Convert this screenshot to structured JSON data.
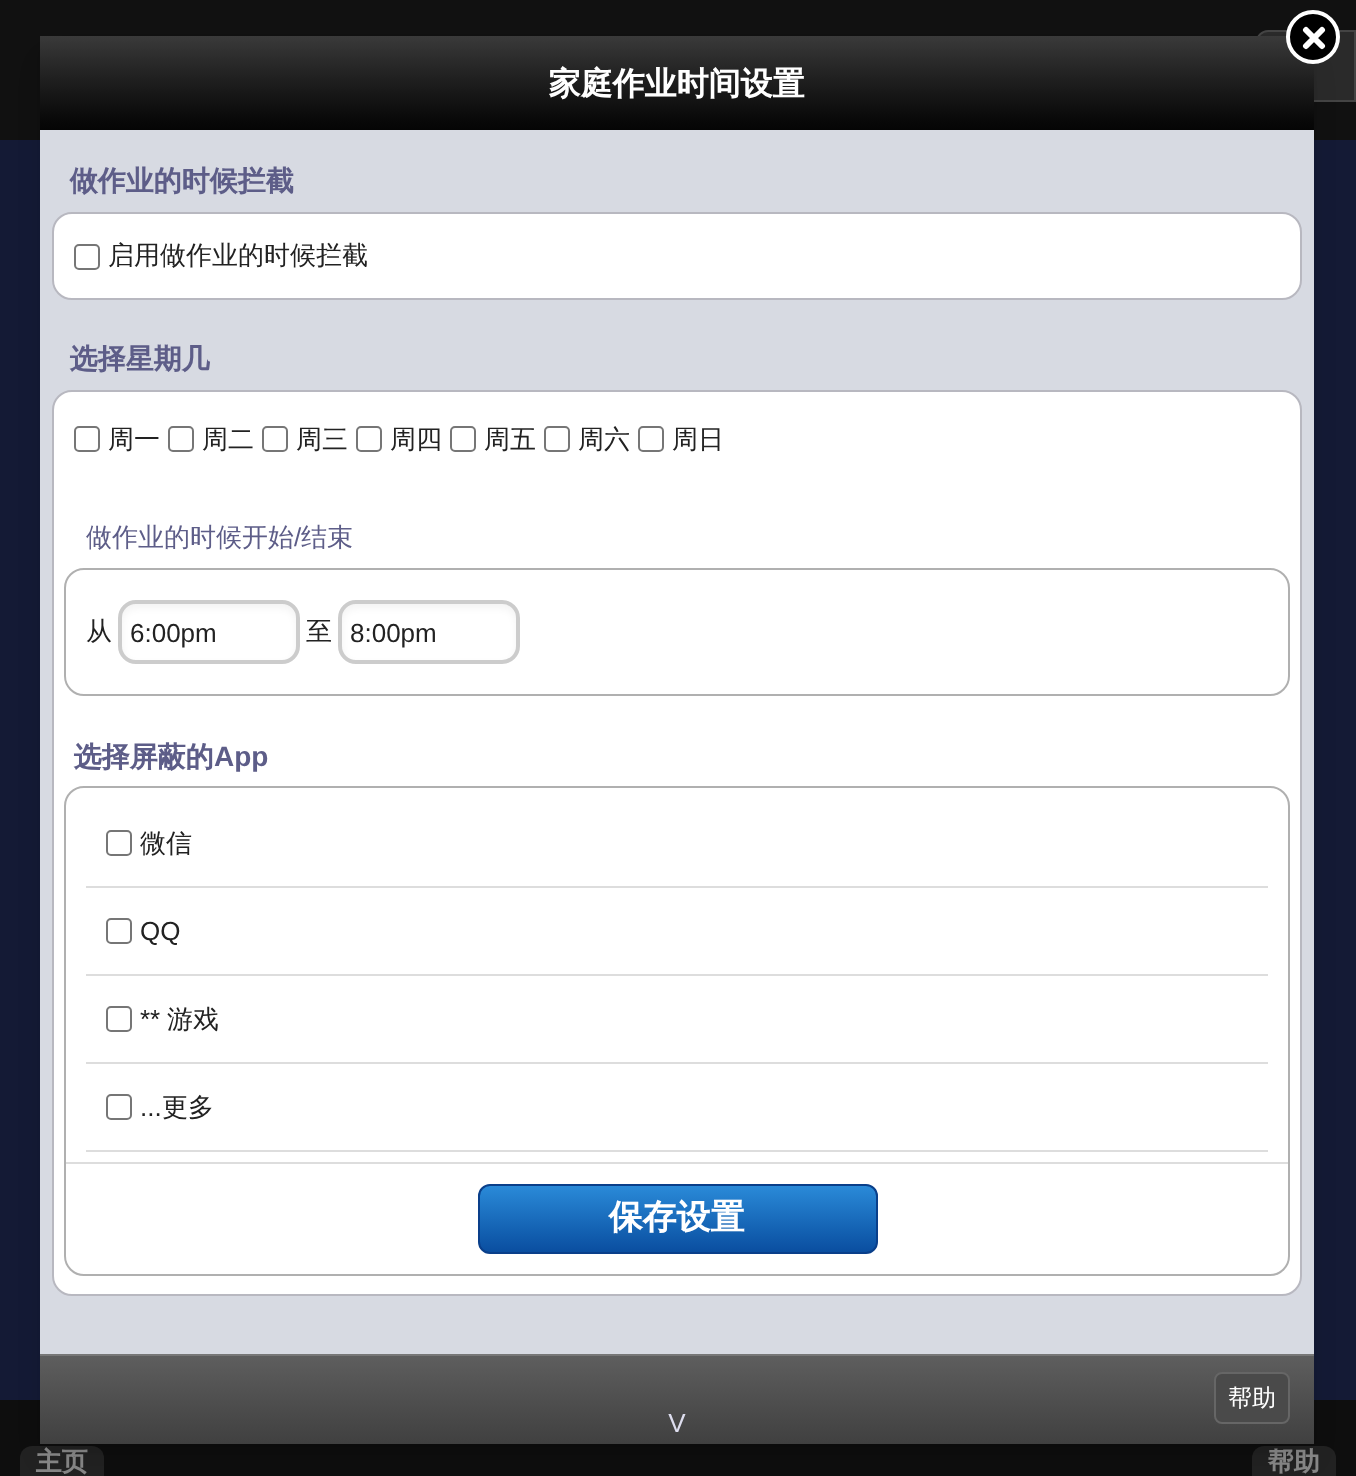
{
  "background": {
    "bottom_nav": [
      {
        "label": "主页"
      },
      {
        "label": "帮助"
      }
    ]
  },
  "dialog": {
    "title": "家庭作业时间设置",
    "intercept": {
      "heading": "做作业的时候拦截",
      "option": {
        "label": "启用做作业的时候拦截",
        "checked": false
      }
    },
    "weekdays": {
      "heading": "选择星期几",
      "days": [
        {
          "label": "周一",
          "checked": false
        },
        {
          "label": "周二",
          "checked": false
        },
        {
          "label": "周三",
          "checked": false
        },
        {
          "label": "周四",
          "checked": false
        },
        {
          "label": "周五",
          "checked": false
        },
        {
          "label": "周六",
          "checked": false
        },
        {
          "label": "周日",
          "checked": false
        }
      ]
    },
    "time": {
      "heading": "做作业的时候开始/结束",
      "from_label": "从",
      "from_value": "6:00pm",
      "to_label": "至",
      "to_value": "8:00pm"
    },
    "apps": {
      "heading": "选择屏蔽的App",
      "items": [
        {
          "label": "微信",
          "checked": false
        },
        {
          "label": "QQ",
          "checked": false
        },
        {
          "label": "** 游戏",
          "checked": false
        },
        {
          "label": "...更多",
          "checked": false
        }
      ]
    },
    "save_button": "保存设置",
    "footer": {
      "toggle": "V",
      "help_button": "帮助"
    }
  }
}
